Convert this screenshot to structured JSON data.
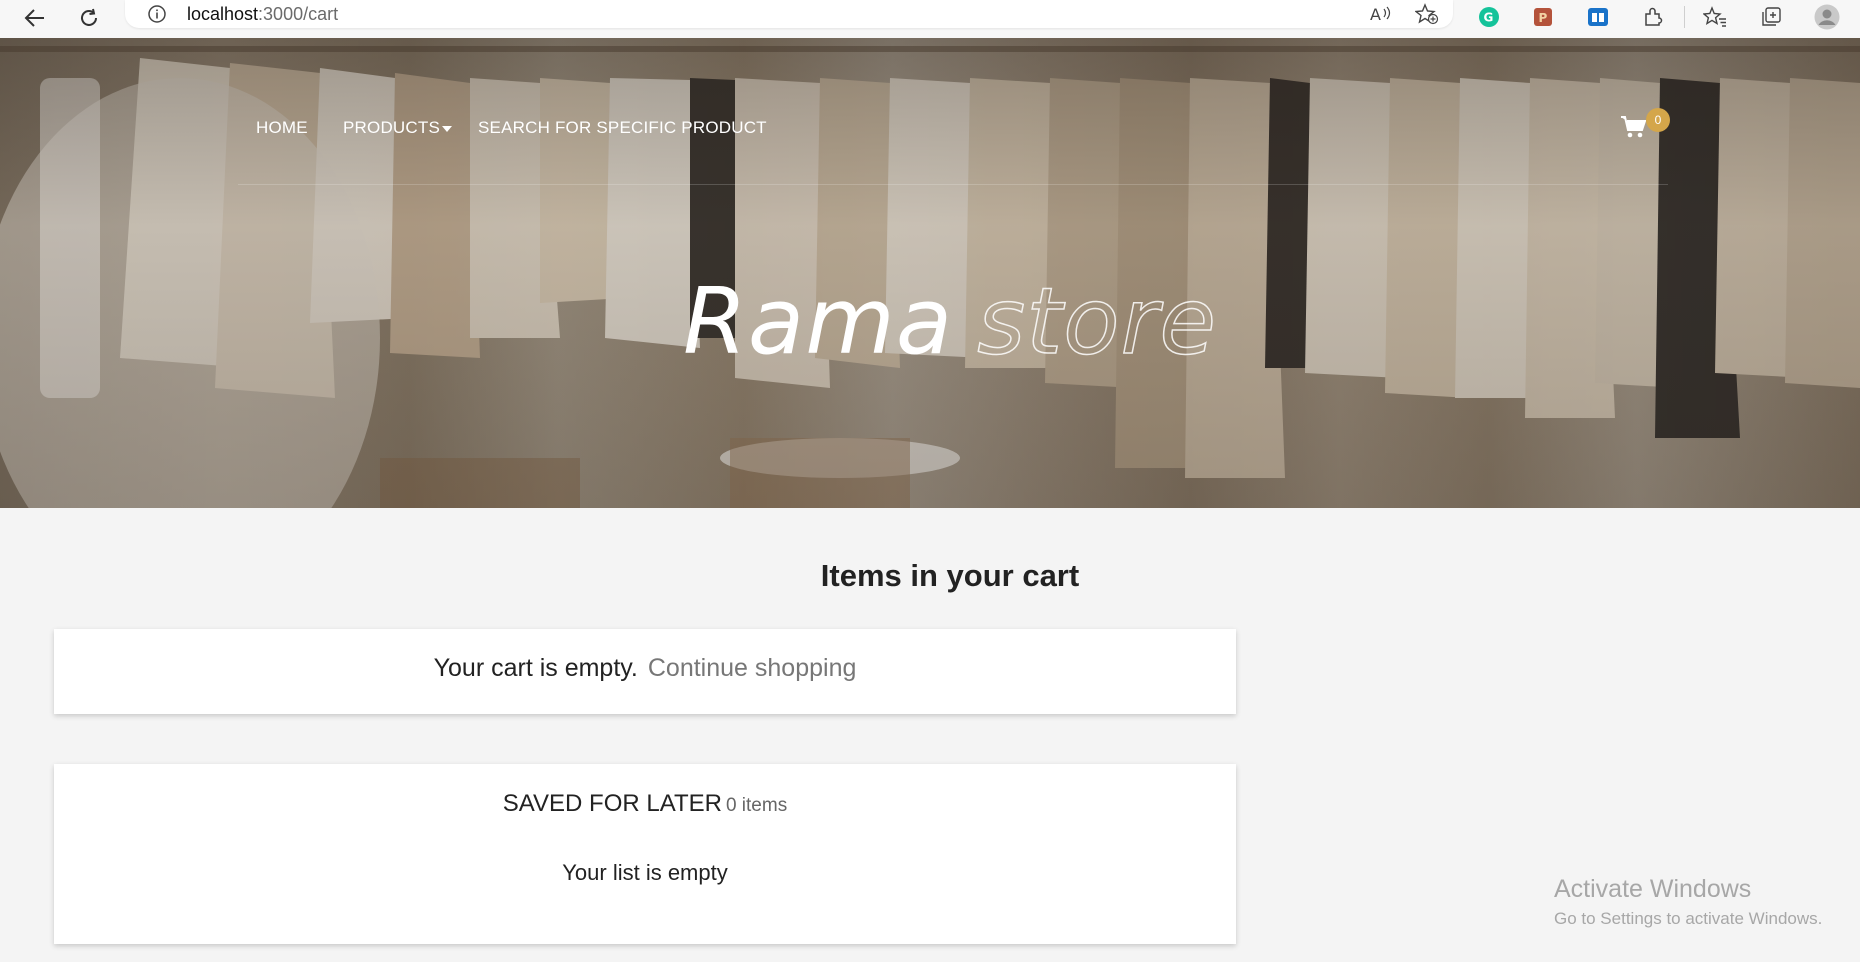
{
  "browser": {
    "url_host": "localhost",
    "url_path": ":3000/cart"
  },
  "nav": {
    "home": "HOME",
    "products": "PRODUCTS",
    "search": "SEARCH FOR SPECIFIC PRODUCT",
    "cart_count": "0"
  },
  "hero": {
    "title_main": "Rama",
    "title_outline": "store"
  },
  "cart": {
    "heading": "Items in your cart",
    "empty_message": "Your cart is empty.",
    "continue_link": "Continue shopping"
  },
  "saved": {
    "title": "SAVED FOR LATER",
    "count": "0 items",
    "empty": "Your list is empty"
  },
  "watermark": {
    "title": "Activate Windows",
    "subtitle": "Go to Settings to activate Windows."
  },
  "colors": {
    "badge": "#d4a64a",
    "link_gray": "#777777",
    "page_bg": "#f4f4f4"
  }
}
